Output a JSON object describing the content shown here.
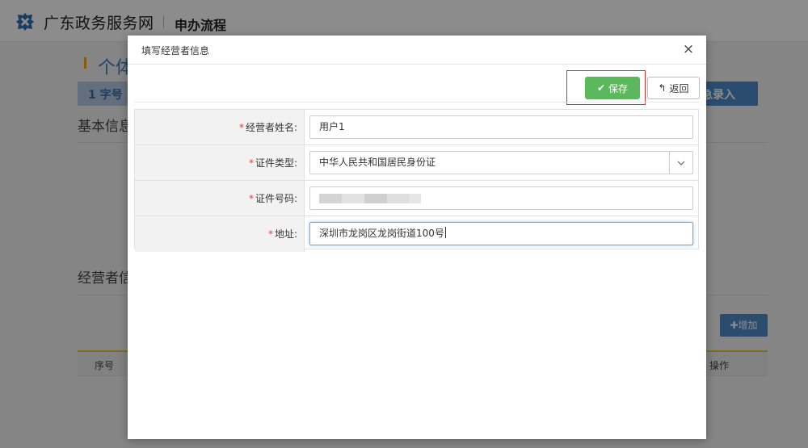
{
  "header": {
    "site_name": "广东政务服务网",
    "process_title": "申办流程"
  },
  "background": {
    "section_title": "个体",
    "step_label": "1 字号",
    "step_right_label": "急录入",
    "basic_info": "基本信息",
    "operator_info": "经营者信",
    "add_button": "增加",
    "table_headers": {
      "seq": "序号",
      "op": "操作"
    }
  },
  "modal": {
    "title": "填写经营者信息",
    "close_symbol": "×",
    "save_label": "保存",
    "back_label": "返回",
    "fields": [
      {
        "label": "经营者姓名:",
        "value": "用户1",
        "required": "*"
      },
      {
        "label": "证件类型:",
        "value": "中华人民共和国居民身份证",
        "required": "*"
      },
      {
        "label": "证件号码:",
        "value": "",
        "required": "*"
      },
      {
        "label": "地址:",
        "value": "深圳市龙岗区龙岗街道100号",
        "required": "*"
      }
    ]
  },
  "icons": {
    "logo": "gdzwfw-logo-icon",
    "save": "check-icon",
    "back": "reply-arrow-icon",
    "add": "plus-icon",
    "select": "chevron-down-icon",
    "close": "close-icon"
  },
  "colors": {
    "save_green": "#5cb85c",
    "highlight_red": "#d9302c",
    "required_red": "#e23b3b",
    "accent_blue": "#4e8ccb",
    "title_blue": "#3a7fc7"
  }
}
